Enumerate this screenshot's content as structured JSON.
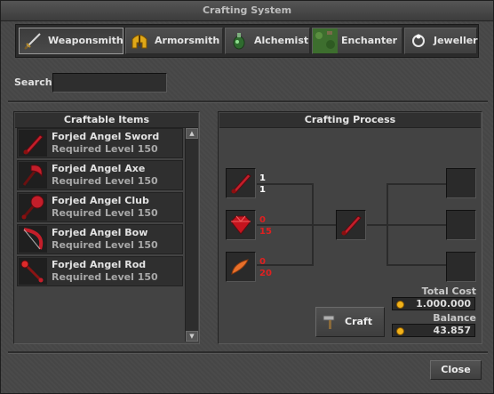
{
  "window": {
    "title": "Crafting System"
  },
  "tabs": [
    {
      "label": "Weaponsmith",
      "icon": "sword-icon",
      "active": true
    },
    {
      "label": "Armorsmith",
      "icon": "helmet-icon",
      "active": false
    },
    {
      "label": "Alchemist",
      "icon": "potion-icon",
      "active": false
    },
    {
      "label": "Enchanter",
      "icon": "enchant-icon",
      "active": false
    },
    {
      "label": "Jeweller",
      "icon": "jewel-icon",
      "active": false
    }
  ],
  "search": {
    "label": "Search",
    "value": ""
  },
  "craftable": {
    "title": "Craftable Items",
    "items": [
      {
        "name": "Forjed Angel Sword",
        "level": "Required Level 150",
        "icon": "red-sword-icon"
      },
      {
        "name": "Forjed Angel Axe",
        "level": "Required Level 150",
        "icon": "red-axe-icon"
      },
      {
        "name": "Forjed Angel Club",
        "level": "Required Level 150",
        "icon": "red-club-icon"
      },
      {
        "name": "Forjed Angel Bow",
        "level": "Required Level 150",
        "icon": "red-bow-icon"
      },
      {
        "name": "Forjed Angel Rod",
        "level": "Required Level 150",
        "icon": "red-rod-icon"
      }
    ]
  },
  "process": {
    "title": "Crafting Process",
    "ingredients": [
      {
        "icon": "red-sword-icon",
        "have": "1",
        "need": "1"
      },
      {
        "icon": "ruby-icon",
        "have": "0",
        "need": "15"
      },
      {
        "icon": "flame-feather-icon",
        "have": "0",
        "need": "20"
      }
    ],
    "result_icon": "red-sword-icon",
    "colors": {
      "sufficient": "#ffffff",
      "insufficient": "#e02020"
    },
    "craft_label": "Craft",
    "total_cost_label": "Total Cost",
    "total_cost": "1.000.000",
    "balance_label": "Balance",
    "balance": "43.857"
  },
  "footer": {
    "close_label": "Close"
  }
}
